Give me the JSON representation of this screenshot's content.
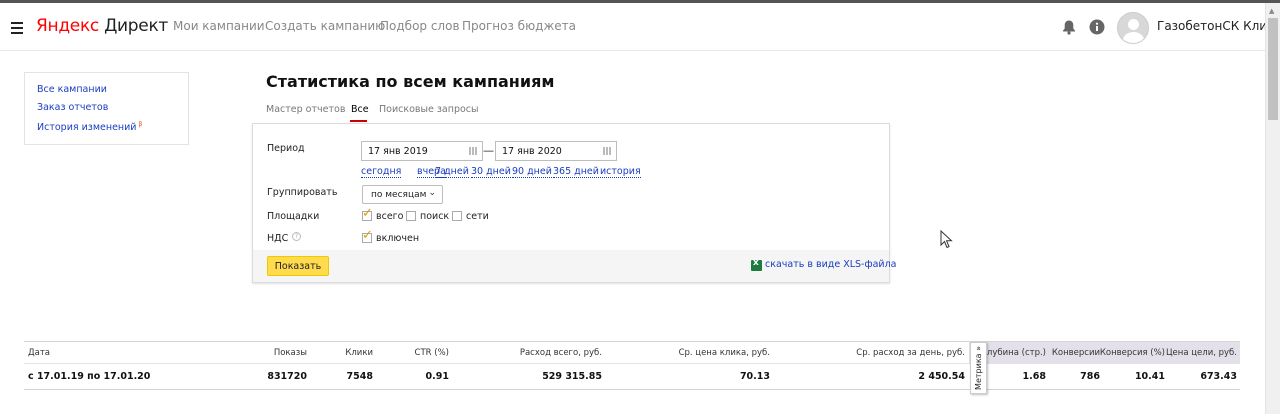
{
  "header": {
    "logo_ya": "Яндекс",
    "logo_rest": " Директ",
    "nav": [
      "Мои кампании",
      "Создать кампанию",
      "Подбор слов",
      "Прогноз бюджета"
    ],
    "username": "ГазобетонСК Клик"
  },
  "sidebar": {
    "items": [
      "Все кампании",
      "Заказ отчетов",
      "История изменений"
    ],
    "beta_mark": "β"
  },
  "page": {
    "title": "Статистика по всем кампаниям",
    "tabs": [
      "Мастер отчетов",
      "Все",
      "Поисковые запросы"
    ],
    "active_tab": "Все"
  },
  "form": {
    "period_label": "Период",
    "date_from": "17 янв 2019",
    "date_to": "17 янв 2020",
    "dash": "—",
    "quick_periods": [
      "сегодня",
      "вчера",
      "7 дней",
      "30 дней",
      "90 дней",
      "365 дней",
      "история"
    ],
    "group_label": "Группировать",
    "group_value": "по месяцам",
    "platforms_label": "Площадки",
    "platforms": [
      {
        "label": "всего",
        "checked": true
      },
      {
        "label": "поиск",
        "checked": false
      },
      {
        "label": "сети",
        "checked": false
      }
    ],
    "vat_label": "НДС",
    "vat_help": "?",
    "vat_option": "включен",
    "show_button": "Показать",
    "xls_link": "скачать в виде XLS-файла"
  },
  "table": {
    "headers": [
      "Дата",
      "Показы",
      "Клики",
      "CTR (%)",
      "Расход всего, руб.",
      "Ср. цена клика, руб.",
      "Ср. расход за день, руб.",
      "Глубина (стр.)",
      "Конверсии",
      "Конверсия (%)",
      "Цена цели, руб."
    ],
    "row": [
      "с 17.01.19 по 17.01.20",
      "831720",
      "7548",
      "0.91",
      "529 315.85",
      "70.13",
      "2 450.54",
      "1.68",
      "786",
      "10.41",
      "673.43"
    ],
    "metrika_tab": "Метрика »"
  },
  "colors": {
    "accent": "#ffdb4d",
    "link": "#1a3dc1",
    "tab_underline": "#cc0000",
    "metrika_bg": "#e4e0ea"
  }
}
